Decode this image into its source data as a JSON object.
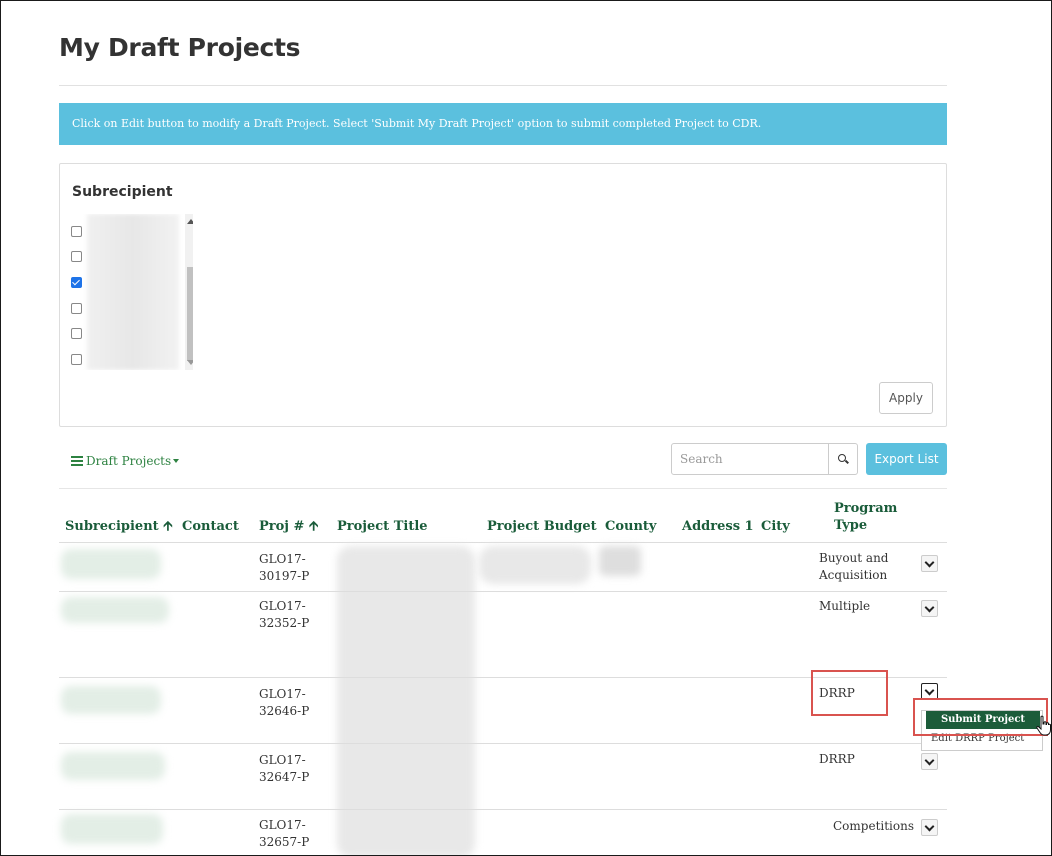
{
  "page": {
    "title": "My Draft Projects"
  },
  "info_message": "Click on Edit button to modify a Draft Project. Select 'Submit My Draft Project' option to submit completed Project to CDR.",
  "filter": {
    "label": "Subrecipient",
    "checkboxes": [
      {
        "checked": false
      },
      {
        "checked": false
      },
      {
        "checked": true
      },
      {
        "checked": false
      },
      {
        "checked": false
      },
      {
        "checked": false
      }
    ],
    "apply_label": "Apply"
  },
  "toolbar": {
    "view_label": "Draft Projects",
    "search_placeholder": "Search",
    "export_label": "Export List"
  },
  "table": {
    "headers": {
      "subrecipient": "Subrecipient",
      "contact": "Contact",
      "proj_no": "Proj #",
      "project_title": "Project Title",
      "project_budget": "Project Budget",
      "county": "County",
      "address1": "Address 1",
      "city": "City",
      "program_type_line1": "Program",
      "program_type_line2": "Type"
    },
    "sort_arrow": "🡩",
    "rows": [
      {
        "proj_line1": "GLO17-",
        "proj_line2": "30197-P",
        "program_line1": "Buyout and",
        "program_line2": "Acquisition"
      },
      {
        "proj_line1": "GLO17-",
        "proj_line2": "32352-P",
        "program_line1": "Multiple",
        "program_line2": ""
      },
      {
        "proj_line1": "GLO17-",
        "proj_line2": "32646-P",
        "program_line1": "DRRP",
        "program_line2": ""
      },
      {
        "proj_line1": "GLO17-",
        "proj_line2": "32647-P",
        "program_line1": "DRRP",
        "program_line2": ""
      },
      {
        "proj_line1": "GLO17-",
        "proj_line2": "32657-P",
        "program_line1": "Competitions",
        "program_line2": ""
      }
    ]
  },
  "row_menu": {
    "items": [
      "Submit Project",
      "Edit DRRP Project"
    ]
  },
  "colors": {
    "header_green": "#1a5c3a",
    "info_blue": "#5bc0de",
    "highlight_red": "#d9534f",
    "menu_primary": "#1c5c3a"
  }
}
